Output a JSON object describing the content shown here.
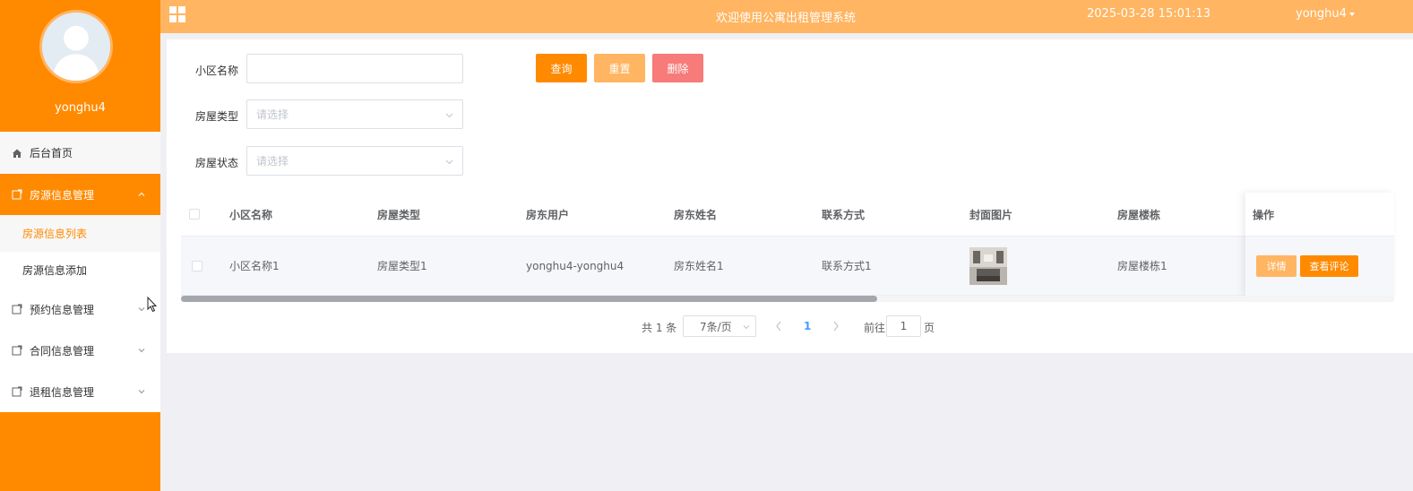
{
  "sidebar": {
    "username": "yonghu4",
    "menu": {
      "home": "后台首页",
      "house_info": "房源信息管理",
      "house_list": "房源信息列表",
      "house_add": "房源信息添加",
      "booking": "预约信息管理",
      "contract": "合同信息管理",
      "checkout": "退租信息管理"
    }
  },
  "topbar": {
    "title": "欢迎使用公寓出租管理系统",
    "datetime": "2025-03-28 15:01:13",
    "user": "yonghu4"
  },
  "search": {
    "community_label": "小区名称",
    "community_value": "",
    "house_type_label": "房屋类型",
    "house_type_placeholder": "请选择",
    "house_status_label": "房屋状态",
    "house_status_placeholder": "请选择",
    "query_btn": "查询",
    "reset_btn": "重置",
    "delete_btn": "删除"
  },
  "table": {
    "headers": {
      "community": "小区名称",
      "type": "房屋类型",
      "owner_user": "房东用户",
      "owner_name": "房东姓名",
      "contact": "联系方式",
      "cover": "封面图片",
      "building": "房屋楼栋",
      "actions": "操作"
    },
    "rows": [
      {
        "community": "小区名称1",
        "type": "房屋类型1",
        "owner_user": "yonghu4-yonghu4",
        "owner_name": "房东姓名1",
        "contact": "联系方式1",
        "building": "房屋楼栋1",
        "detail_btn": "详情",
        "review_btn": "查看评论"
      }
    ]
  },
  "pagination": {
    "total": "共 1 条",
    "page_size": "7条/页",
    "current": "1",
    "goto_label": "前往",
    "goto_value": "1",
    "page_suffix": "页"
  },
  "colors": {
    "primary": "#ff8a00",
    "light": "#ffb561",
    "danger": "#f67b79",
    "link": "#409eff"
  }
}
